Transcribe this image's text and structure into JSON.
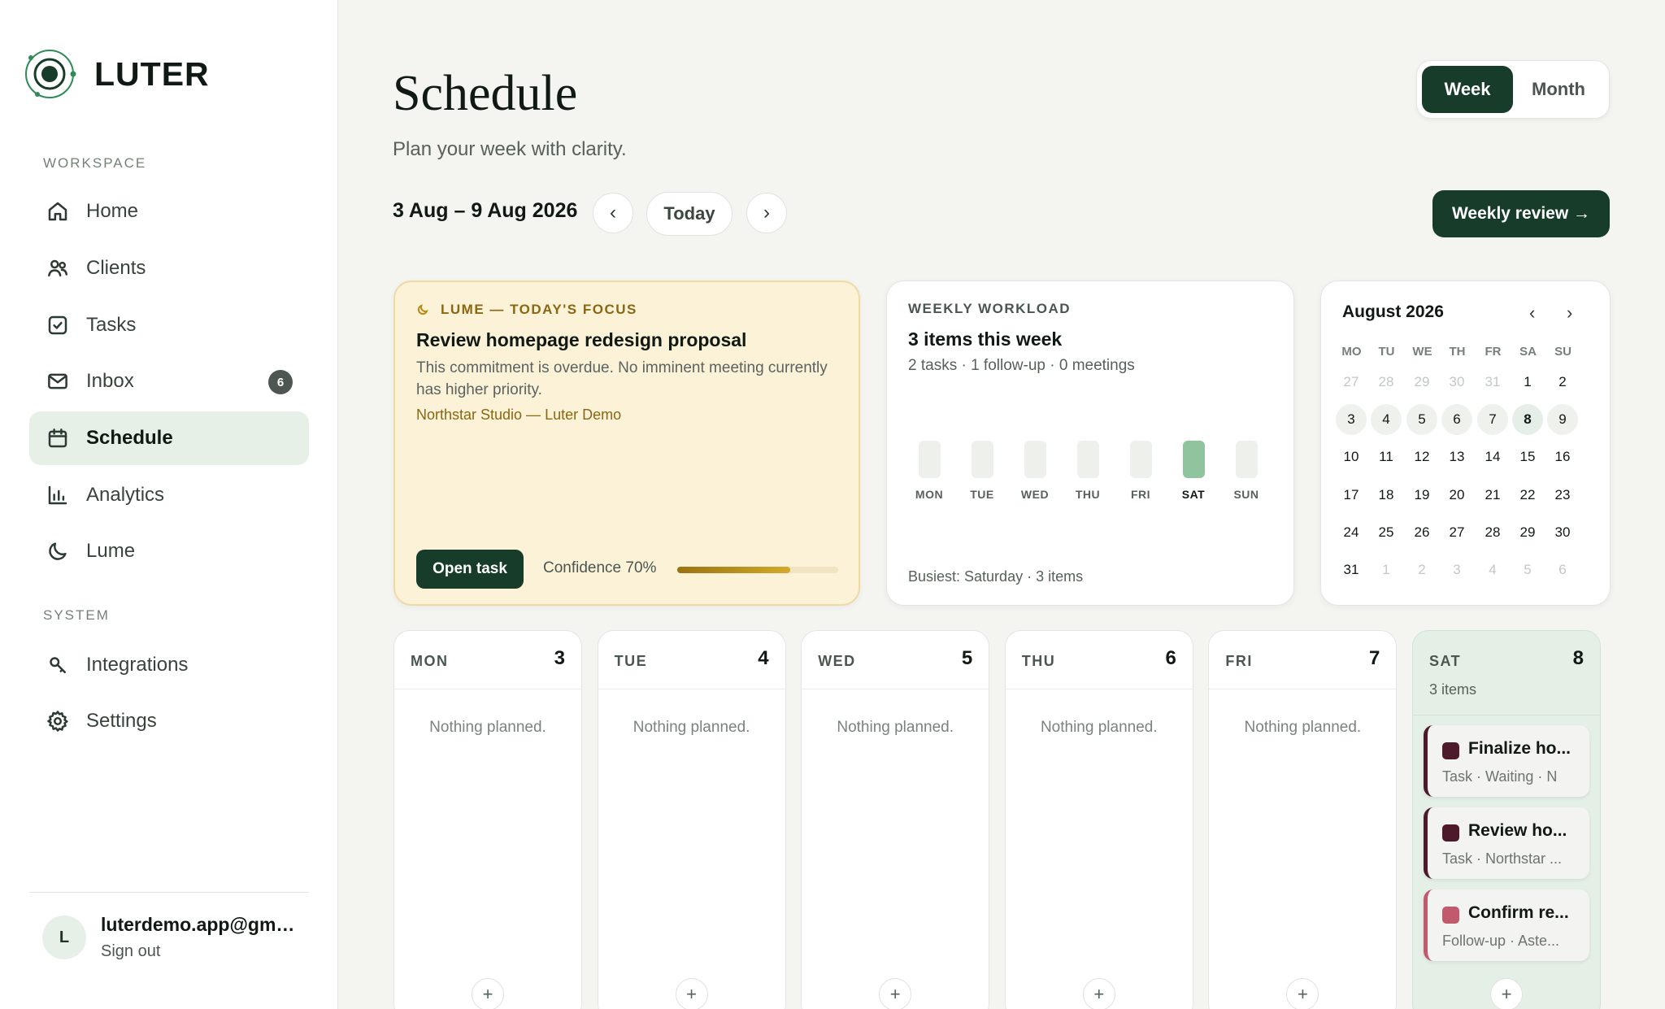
{
  "brand": {
    "name": "LUTER"
  },
  "sidebar": {
    "workspace_label": "WORKSPACE",
    "system_label": "SYSTEM",
    "workspace_items": [
      {
        "label": "Home",
        "icon": "home-icon"
      },
      {
        "label": "Clients",
        "icon": "users-icon"
      },
      {
        "label": "Tasks",
        "icon": "checkbox-icon"
      },
      {
        "label": "Inbox",
        "icon": "mail-icon",
        "badge": "6"
      },
      {
        "label": "Schedule",
        "icon": "calendar-icon",
        "active": true
      },
      {
        "label": "Analytics",
        "icon": "bar-chart-icon"
      },
      {
        "label": "Lume",
        "icon": "moon-icon"
      }
    ],
    "system_items": [
      {
        "label": "Integrations",
        "icon": "key-icon"
      },
      {
        "label": "Settings",
        "icon": "gear-icon"
      }
    ],
    "user": {
      "initial": "L",
      "email": "luterdemo.app@gmail.com",
      "sign_out": "Sign out"
    }
  },
  "header": {
    "title": "Schedule",
    "subtitle": "Plan your week with clarity.",
    "view_toggle": {
      "week": "Week",
      "month": "Month",
      "selected": "Week"
    },
    "range": "3 Aug – 9 Aug 2026",
    "prev": "‹",
    "today": "Today",
    "next": "›",
    "weekly_review": "Weekly review →"
  },
  "focus": {
    "label": "LUME — TODAY'S FOCUS",
    "title": "Review homepage redesign proposal",
    "description": "This commitment is overdue. No imminent meeting currently has higher priority.",
    "client": "Northstar Studio — Luter Demo",
    "open_task": "Open task",
    "confidence_label": "Confidence 70%",
    "confidence": 0.7
  },
  "workload": {
    "label": "WEEKLY WORKLOAD",
    "title": "3 items this week",
    "subtitle": "2 tasks · 1 follow-up · 0 meetings",
    "days": [
      {
        "day": "MON",
        "items": 0
      },
      {
        "day": "TUE",
        "items": 0
      },
      {
        "day": "WED",
        "items": 0
      },
      {
        "day": "THU",
        "items": 0
      },
      {
        "day": "FRI",
        "items": 0
      },
      {
        "day": "SAT",
        "items": 3
      },
      {
        "day": "SUN",
        "items": 0
      }
    ],
    "busiest": "Busiest: Saturday · 3 items"
  },
  "mini_calendar": {
    "title": "August 2026",
    "prev": "‹",
    "next": "›",
    "weekdays": [
      "MO",
      "TU",
      "WE",
      "TH",
      "FR",
      "SA",
      "SU"
    ],
    "rows": [
      [
        "27",
        "28",
        "29",
        "30",
        "31",
        "1",
        "2"
      ],
      [
        "3",
        "4",
        "5",
        "6",
        "7",
        "8",
        "9"
      ],
      [
        "10",
        "11",
        "12",
        "13",
        "14",
        "15",
        "16"
      ],
      [
        "17",
        "18",
        "19",
        "20",
        "21",
        "22",
        "23"
      ],
      [
        "24",
        "25",
        "26",
        "27",
        "28",
        "29",
        "30"
      ],
      [
        "31",
        "1",
        "2",
        "3",
        "4",
        "5",
        "6"
      ]
    ],
    "today": "8"
  },
  "days": [
    {
      "name": "MON",
      "num": "3",
      "empty": "Nothing planned.",
      "add": "+"
    },
    {
      "name": "TUE",
      "num": "4",
      "empty": "Nothing planned.",
      "add": "+"
    },
    {
      "name": "WED",
      "num": "5",
      "empty": "Nothing planned.",
      "add": "+"
    },
    {
      "name": "THU",
      "num": "6",
      "empty": "Nothing planned.",
      "add": "+"
    },
    {
      "name": "FRI",
      "num": "7",
      "empty": "Nothing planned.",
      "add": "+"
    },
    {
      "name": "SAT",
      "num": "8",
      "count": "3 items",
      "add": "+",
      "events": [
        {
          "title": "Finalize ho...",
          "meta": "Task · Waiting · N",
          "color": "#4c1a2a"
        },
        {
          "title": "Review ho...",
          "meta": "Task · Northstar ...",
          "color": "#4c1a2a"
        },
        {
          "title": "Confirm re...",
          "meta": "Follow-up · Aste...",
          "color": "#c25a6e"
        }
      ]
    }
  ]
}
